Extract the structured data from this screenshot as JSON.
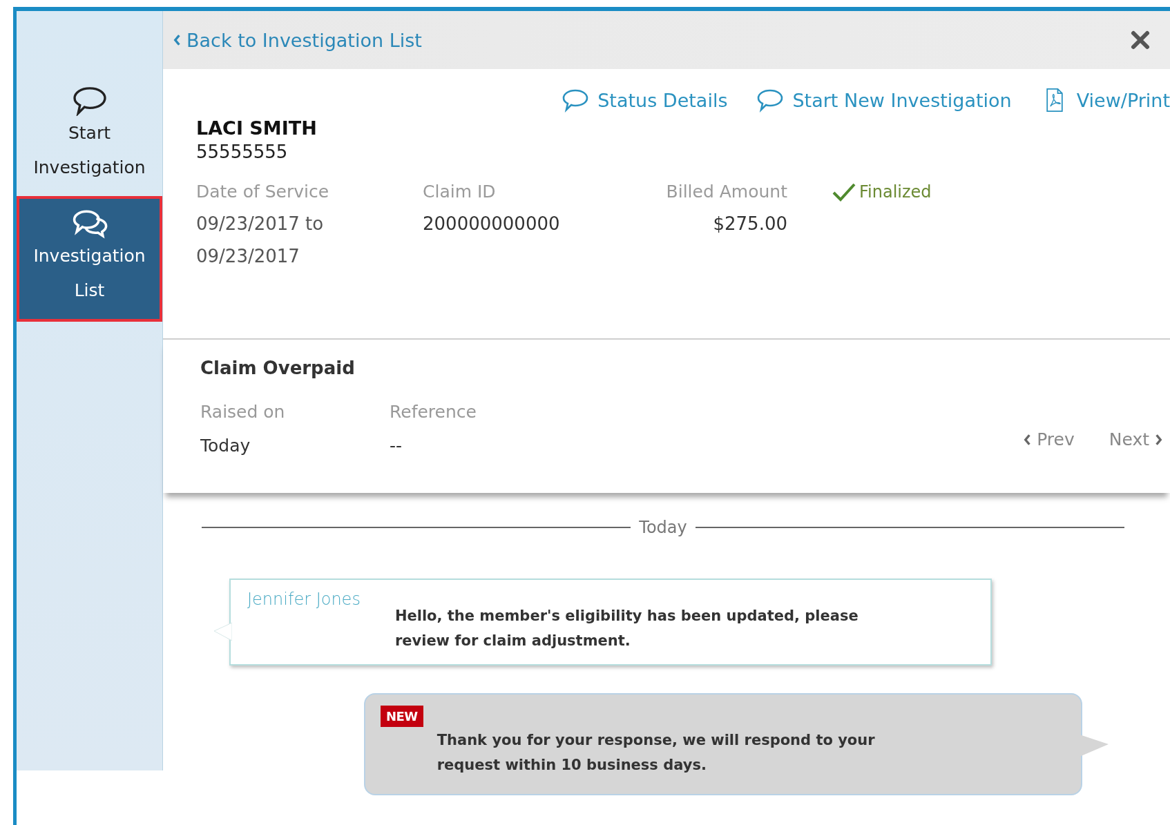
{
  "sidebar": {
    "items": [
      {
        "label": "Start Investigation",
        "kind": "start",
        "selected": false
      },
      {
        "label": "Investigation List",
        "kind": "list",
        "selected": true
      }
    ]
  },
  "top_bar": {
    "back_link": "Back to Investigation List"
  },
  "actions": [
    {
      "label": "Status Details",
      "kind": "chat"
    },
    {
      "label": "Start New Investigation",
      "kind": "chat"
    },
    {
      "label": "View/Print",
      "kind": "document"
    }
  ],
  "member": {
    "name": "LACI SMITH",
    "id": "55555555"
  },
  "claim_fields": [
    {
      "label": "Date of Service",
      "value": "09/23/2017 to 09/23/2017"
    },
    {
      "label": "Claim ID",
      "value": "200000000000"
    },
    {
      "label": "Billed Amount",
      "value": "$275.00"
    }
  ],
  "status": "Finalized",
  "investigation": {
    "title": "Claim Overpaid",
    "fields": [
      {
        "label": "Raised on",
        "value": "Today"
      },
      {
        "label": "Reference",
        "value": "--"
      }
    ],
    "prev": "Prev",
    "next": "Next"
  },
  "date_divider": "Today",
  "messages": [
    {
      "kind": "incoming",
      "author": "Jennifer Jones",
      "text": "Hello, the member's eligibility has been updated, please review for claim adjustment."
    },
    {
      "kind": "outgoing",
      "badge": "NEW",
      "text": "Thank you for your response, we will respond to your request within 10 business days."
    }
  ]
}
